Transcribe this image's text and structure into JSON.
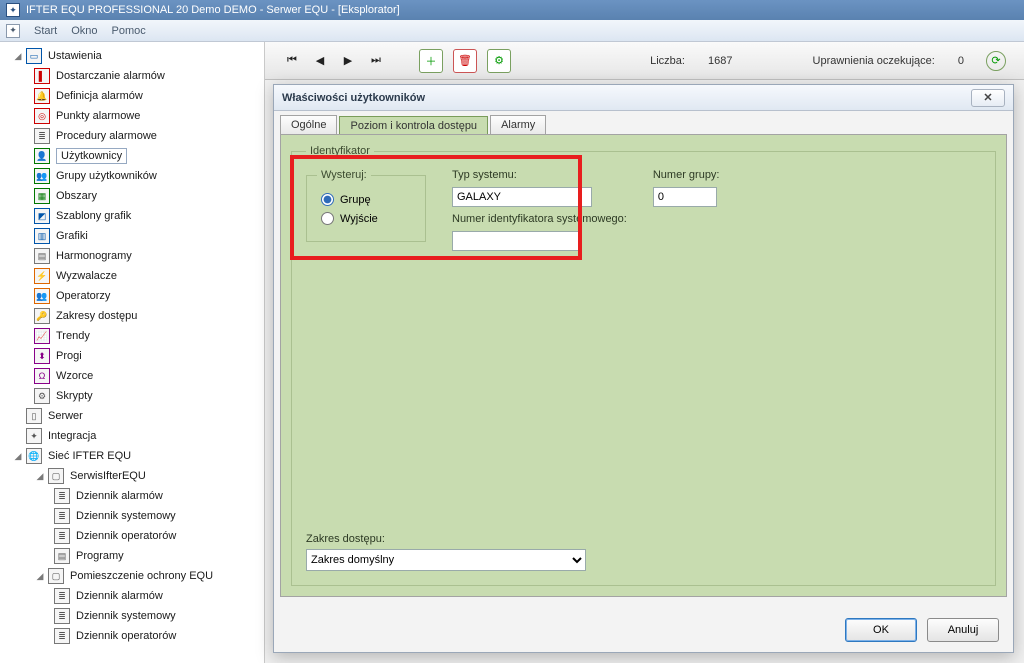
{
  "window": {
    "title": "IFTER EQU PROFESSIONAL 20 Demo  DEMO - Serwer EQU - [Eksplorator]"
  },
  "menu": {
    "start": "Start",
    "okno": "Okno",
    "pomoc": "Pomoc"
  },
  "toolbar": {
    "liczba_label": "Liczba:",
    "liczba_value": "1687",
    "uprawnienia_label": "Uprawnienia oczekujące:",
    "uprawnienia_value": "0"
  },
  "tree": {
    "ustawienia": "Ustawienia",
    "items": [
      "Dostarczanie alarmów",
      "Definicja alarmów",
      "Punkty alarmowe",
      "Procedury alarmowe",
      "Użytkownicy",
      "Grupy użytkowników",
      "Obszary",
      "Szablony grafik",
      "Grafiki",
      "Harmonogramy",
      "Wyzwalacze",
      "Operatorzy",
      "Zakresy dostępu",
      "Trendy",
      "Progi",
      "Wzorce",
      "Skrypty"
    ],
    "serwer": "Serwer",
    "integracja": "Integracja",
    "siec": "Sieć IFTER EQU",
    "serwis": "SerwisIfterEQU",
    "serwis_children": [
      "Dziennik alarmów",
      "Dziennik systemowy",
      "Dziennik operatorów",
      "Programy"
    ],
    "pomieszczenie": "Pomieszczenie ochrony EQU",
    "pom_children": [
      "Dziennik alarmów",
      "Dziennik systemowy",
      "Dziennik operatorów"
    ]
  },
  "props": {
    "title": "Właściwości użytkowników",
    "tabs": {
      "ogolne": "Ogólne",
      "poziom": "Poziom i kontrola dostępu",
      "alarmy": "Alarmy"
    },
    "group": {
      "identyfikator": "Identyfikator",
      "wysteruj": "Wysteruj:",
      "grupe": "Grupę",
      "wyjscie": "Wyjście",
      "typ_label": "Typ systemu:",
      "typ_value": "GALAXY",
      "numer_grupy_label": "Numer grupy:",
      "numer_grupy_value": "0",
      "numer_id_label": "Numer identyfikatora systemowego:",
      "numer_id_value": "",
      "zakres_label": "Zakres dostępu:",
      "zakres_value": "Zakres domyślny"
    },
    "buttons": {
      "ok": "OK",
      "cancel": "Anuluj"
    }
  }
}
